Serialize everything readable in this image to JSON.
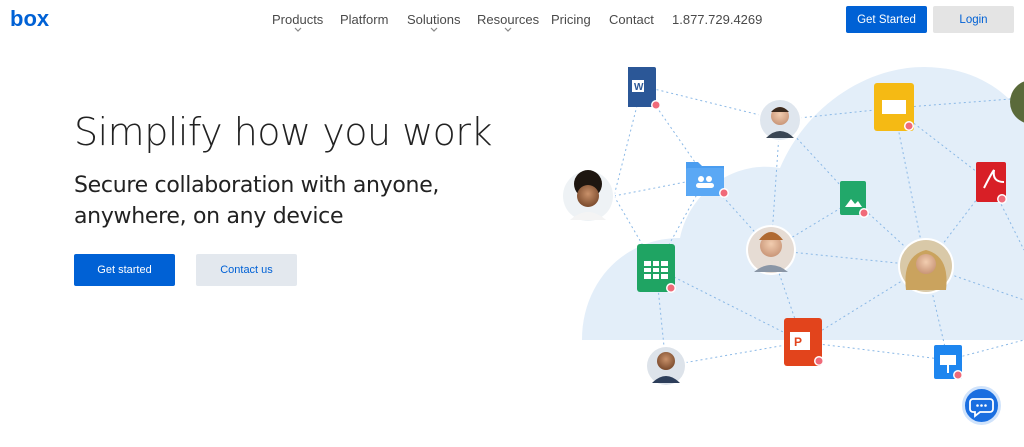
{
  "header": {
    "logo_text": "box",
    "nav": [
      {
        "label": "Products",
        "has_dropdown": true
      },
      {
        "label": "Platform",
        "has_dropdown": false
      },
      {
        "label": "Solutions",
        "has_dropdown": true
      },
      {
        "label": "Resources",
        "has_dropdown": true
      },
      {
        "label": "Pricing",
        "has_dropdown": false
      },
      {
        "label": "Contact",
        "has_dropdown": false
      }
    ],
    "phone": "1.877.729.4269",
    "get_started_label": "Get Started",
    "login_label": "Login"
  },
  "hero": {
    "title": "Simplify how you work",
    "subtitle": "Secure collaboration with anyone, anywhere, on any device",
    "primary_cta": "Get started",
    "secondary_cta": "Contact us"
  },
  "illustration": {
    "file_icons": [
      "word-doc-icon",
      "shared-folder-icon",
      "google-sheets-icon",
      "google-slides-icon",
      "google-image-icon",
      "pdf-icon",
      "powerpoint-icon",
      "keynote-icon"
    ],
    "avatars": 6
  },
  "colors": {
    "brand_blue": "#0061d5",
    "cloud": "#e3eef9",
    "connector": "#8ab8e6"
  }
}
